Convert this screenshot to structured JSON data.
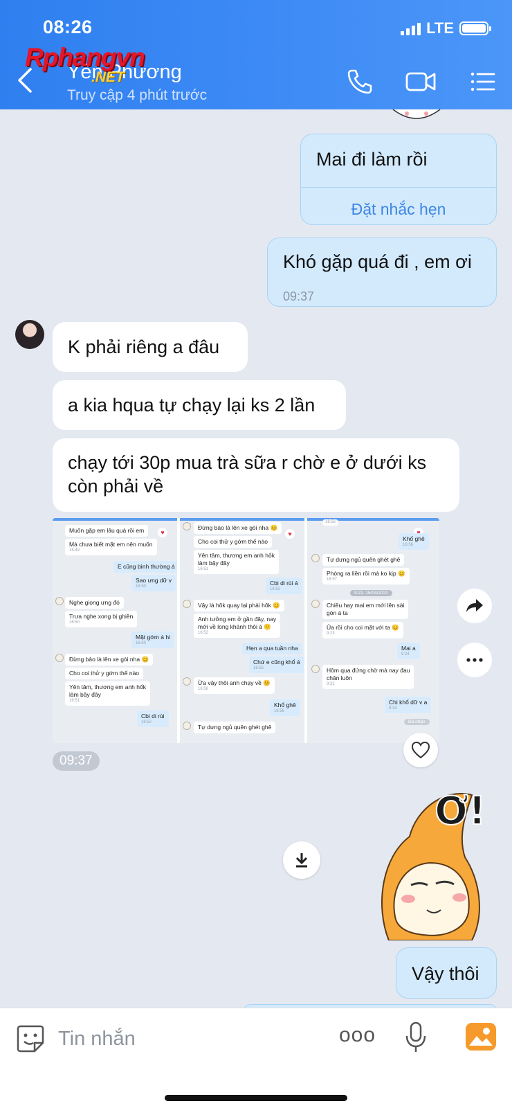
{
  "status_bar": {
    "time": "08:26",
    "network": "LTE"
  },
  "header": {
    "contact_name": "Yến Phương",
    "contact_status": "Truy cập 4 phút trước"
  },
  "watermark": {
    "main": "Rphangvn",
    "sub": ".NET"
  },
  "messages": {
    "m1": {
      "text": "Mai đi làm rồi",
      "action": "Đặt nhắc hẹn"
    },
    "m2": {
      "text": "Khó gặp quá đi , em ơi",
      "time": "09:37"
    },
    "m3": {
      "text": "K phải riêng a đâu"
    },
    "m4": {
      "text": "a kia hqua tự chạy lại ks 2 lần"
    },
    "m5": {
      "line1": "chạy tới 30p mua trà sữa r chờ e ở dưới ks",
      "line2": "còn phải về"
    },
    "photo_time": "09:37",
    "m6": {
      "text": "Vậy thôi"
    }
  },
  "screenshot_images": {
    "col1": {
      "a": "Muốn gặp em lâu quá rồi em",
      "b": "Mà chưa biết mặt em nên muốn",
      "b_t": "16:49",
      "c": "E cũng bình thường á",
      "d": "Sao ưng dữ v",
      "d_t": "16:50",
      "e": "Nghe giọng ưng đó",
      "f": "Trưa nghe xong bị ghiền",
      "f_t": "16:50",
      "g": "Mặt gớm á hi",
      "g_t": "16:50",
      "h": "Đừng bảo là lên xe gòi nha 😊",
      "i": "Cho coi thử y gớm thế nào",
      "j1": "Yên tâm, thương em anh hốk",
      "j2": "làm bậy đây",
      "j_t": "16:51",
      "k": "Cbi di rùi",
      "k_t": "16:52"
    },
    "col2": {
      "a": "Đừng bảo là lên xe gòi nha 😊",
      "b": "Cho coi thử y gớm thế nào",
      "c1": "Yên tâm, thương em anh hốk",
      "c2": "làm bậy đây",
      "c_t": "16:51",
      "d": "Cbi di rùi á",
      "d_t": "16:52",
      "e": "Vậy là hôk quay lại phải hôk 😊",
      "f1": "Anh tưởng em ở gần đây, nay",
      "f2": "mới về long khánh thôi á 🙂",
      "f_t": "16:52",
      "g": "Hẹn a qua tuần nha",
      "h": "Chứ e cũng khổ á",
      "h_t": "16:55",
      "i": "Ừa vậy thôi anh chạy về 😊",
      "i_t": "16:56",
      "j": "Khổ ghê",
      "j_t": "16:56",
      "k": "Tự dưng ngủ quên ghét ghê"
    },
    "col3": {
      "a_t": "16:56",
      "b": "Khổ ghê",
      "b_t": "16:56",
      "c": "Tự dưng ngủ quên ghét ghê",
      "d": "Phóng ra liền rồi mà ko kịp 😊",
      "d_t": "16:57",
      "date": "9:22, 15/04/2021",
      "e1": "Chiều hay mai em mới lên sài",
      "e2": "gòn á ta",
      "f": "Ủa rồi cho coi mặt với ta 😊",
      "f_t": "9:23",
      "g": "Mai a",
      "g_t": "9:24",
      "h1": "Hôm qua đứng chờ mà nay đau",
      "h2": "chân luôn",
      "h_t": "9:31",
      "i": "Chi khổ dữ v a",
      "i_t": "9:34",
      "seen": "Đã nhận"
    }
  },
  "composer": {
    "placeholder": "Tin nhắn",
    "more": "ooo"
  },
  "colors": {
    "header_blue": "#3f8cf6",
    "outgoing_bubble": "#d3eafd",
    "background": "#e4e8f0"
  }
}
